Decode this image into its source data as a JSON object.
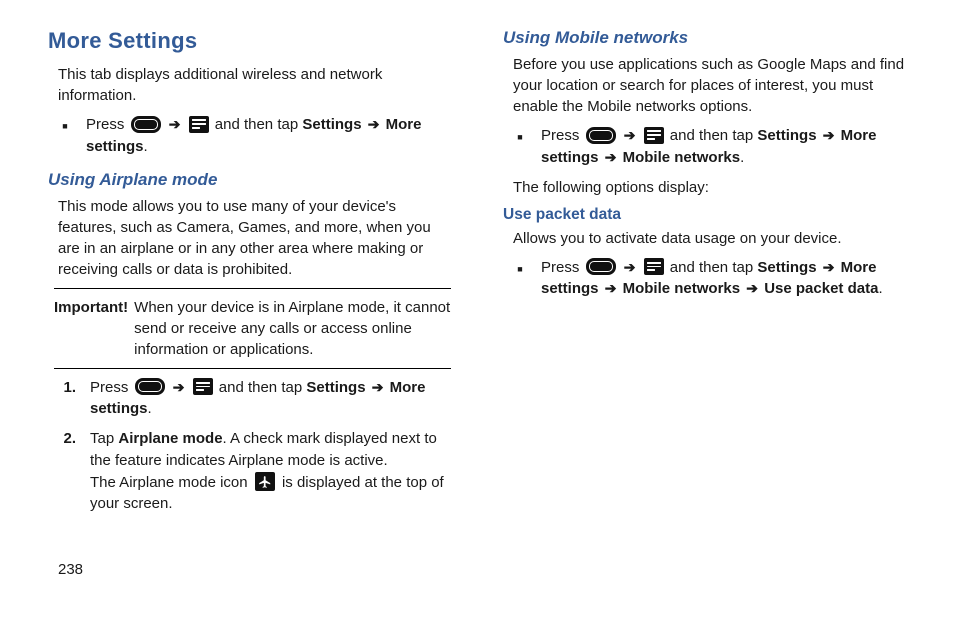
{
  "left": {
    "title": "More Settings",
    "intro": "This tab displays additional wireless and network information.",
    "bullet1": {
      "press": "Press",
      "andThenTap": "and then tap",
      "settings": "Settings",
      "moresettings": "More settings"
    },
    "airplaneHeading": "Using Airplane mode",
    "airplaneBody": "This mode allows you to use many of your device's features, such as Camera, Games, and more, when you are in an airplane or in any other area where making or receiving calls or data is prohibited.",
    "importantLabel": "Important!",
    "importantText": "When your device is in Airplane mode, it cannot send or receive any calls or access online information or applications.",
    "step1": {
      "n": "1.",
      "press": "Press",
      "andThenTap": "and then tap",
      "settings": "Settings",
      "moresettings": "More settings"
    },
    "step2": {
      "n": "2.",
      "tap": "Tap",
      "airplaneMode": "Airplane mode",
      "rest1": ". A check mark displayed next to the feature indicates Airplane mode is active.",
      "rest2a": "The Airplane mode icon",
      "rest2b": "is displayed at the top of your screen."
    }
  },
  "right": {
    "mobileHeading": "Using Mobile networks",
    "mobileBody": "Before you use applications such as Google Maps and find your location or search for places of interest, you must enable the Mobile networks options.",
    "bullet1": {
      "press": "Press",
      "andThenTap": "and then tap",
      "settings": "Settings",
      "moresettings": "More settings",
      "mobilenetworks": "Mobile networks"
    },
    "following": "The following options display:",
    "packetHeading": "Use packet data",
    "packetBody": "Allows you to activate data usage on your device.",
    "bullet2": {
      "press": "Press",
      "andThenTap": "and then tap",
      "settings": "Settings",
      "moresettings": "More settings",
      "mobilenetworks": "Mobile networks",
      "usepacket": "Use packet data"
    }
  },
  "pageNum": "238"
}
